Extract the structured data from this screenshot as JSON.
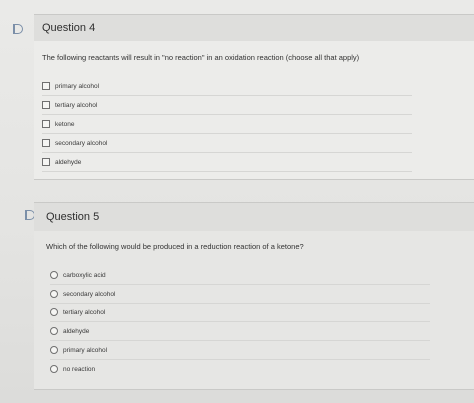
{
  "questions": [
    {
      "title": "Question 4",
      "prompt": "The following reactants will result in \"no reaction\" in an oxidation reaction (choose all that apply)",
      "input_type": "checkbox",
      "options": [
        "primary alcohol",
        "tertiary alcohol",
        "ketone",
        "secondary alcohol",
        "aldehyde"
      ]
    },
    {
      "title": "Question 5",
      "prompt": "Which of the following would be produced in a reduction reaction of a ketone?",
      "input_type": "radio",
      "options": [
        "carboxylic acid",
        "secondary alcohol",
        "tertiary alcohol",
        "aldehyde",
        "primary alcohol",
        "no reaction"
      ]
    }
  ]
}
